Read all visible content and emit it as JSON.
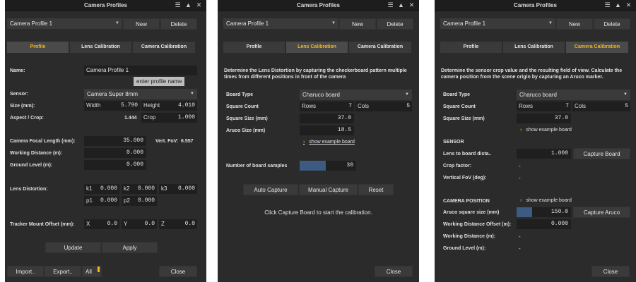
{
  "title": "Camera Profiles",
  "profile_select": "Camera Profile 1",
  "new_label": "New",
  "delete_label": "Delete",
  "tabs": [
    "Profile",
    "Lens Calibration",
    "Camera Calibration"
  ],
  "close_label": "Close",
  "profile": {
    "name_label": "Name:",
    "name_value": "Camera Profile 1",
    "name_tooltip": "enter profile name",
    "sensor_label": "Sensor:",
    "sensor_value": "Camera Super 8mm",
    "size_label": "Size (mm):",
    "width_label": "Width",
    "width_value": "5.790",
    "height_label": "Height",
    "height_value": "4.010",
    "aspect_label": "Aspect / Crop:",
    "aspect_value": "1.444",
    "crop_label": "Crop",
    "crop_value": "1.000",
    "focal_label": "Camera Focal Length (mm):",
    "focal_value": "35.000",
    "vfov_label": "Vert. FoV:",
    "vfov_value": "6.557",
    "working_label": "Working Distance (m):",
    "working_value": "0.000",
    "ground_label": "Ground Level (m):",
    "ground_value": "0.000",
    "lens_label": "Lens Distortion:",
    "k1": "k1",
    "k1_value": "0.000",
    "k2": "k2",
    "k2_value": "0.000",
    "k3": "k3",
    "k3_value": "0.000",
    "p1": "p1",
    "p1_value": "0.000",
    "p2": "p2",
    "p2_value": "0.000",
    "tracker_label": "Tracker Mount Offset (mm):",
    "x": "X",
    "x_value": "0.0",
    "y": "Y",
    "y_value": "0.0",
    "z": "Z",
    "z_value": "0.0",
    "update_label": "Update",
    "apply_label": "Apply",
    "import_label": "Import..",
    "export_label": "Export..",
    "all_label": "All"
  },
  "lens": {
    "description": "Determine the Lens Distortion by capturing the checkerboard pattern multiple times from different positions in front of the camera",
    "board_type_label": "Board Type",
    "board_type_value": "Charuco board",
    "square_count_label": "Square Count",
    "rows_label": "Rows",
    "rows_value": "7",
    "cols_label": "Cols",
    "cols_value": "5",
    "square_size_label": "Square Size (mm)",
    "square_size_value": "37.0",
    "aruco_size_label": "Aruco Size (mm)",
    "aruco_size_value": "18.5",
    "show_example": "show example board",
    "samples_label": "Number of board samples",
    "samples_value": "30",
    "auto_capture": "Auto Capture",
    "manual_capture": "Manual Capture",
    "reset": "Reset",
    "note": "Click Capture Board to start the calibration."
  },
  "camera": {
    "description": "Determine the sensor crop value and the resulting field of view. Calculate the camera position from the scene origin by capturing an Aruco marker.",
    "board_type_label": "Board Type",
    "board_type_value": "Charuco board",
    "square_count_label": "Square Count",
    "rows_label": "Rows",
    "rows_value": "7",
    "cols_label": "Cols",
    "cols_value": "5",
    "square_size_label": "Square Size (mm)",
    "square_size_value": "37.0",
    "show_example": "show example board",
    "sensor_heading": "SENSOR",
    "lens_board_label": "Lens to board dista..",
    "lens_board_value": "1.000",
    "capture_board": "Capture Board",
    "crop_factor_label": "Crop factor:",
    "crop_factor_value": "-",
    "vfov_label": "Vertical FoV (deg):",
    "vfov_value": "-",
    "position_heading": "CAMERA POSITION",
    "show_example2": "show example board",
    "aruco_square_label": "Aruco square size (mm)",
    "aruco_square_value": "150.0",
    "capture_aruco": "Capture Aruco",
    "wd_offset_label": "Working Distance Offset (m):",
    "wd_offset_value": "0.000",
    "wd_label": "Working Distance (m):",
    "wd_value": "-",
    "ground_label": "Ground Level (m):",
    "ground_value": "-"
  }
}
